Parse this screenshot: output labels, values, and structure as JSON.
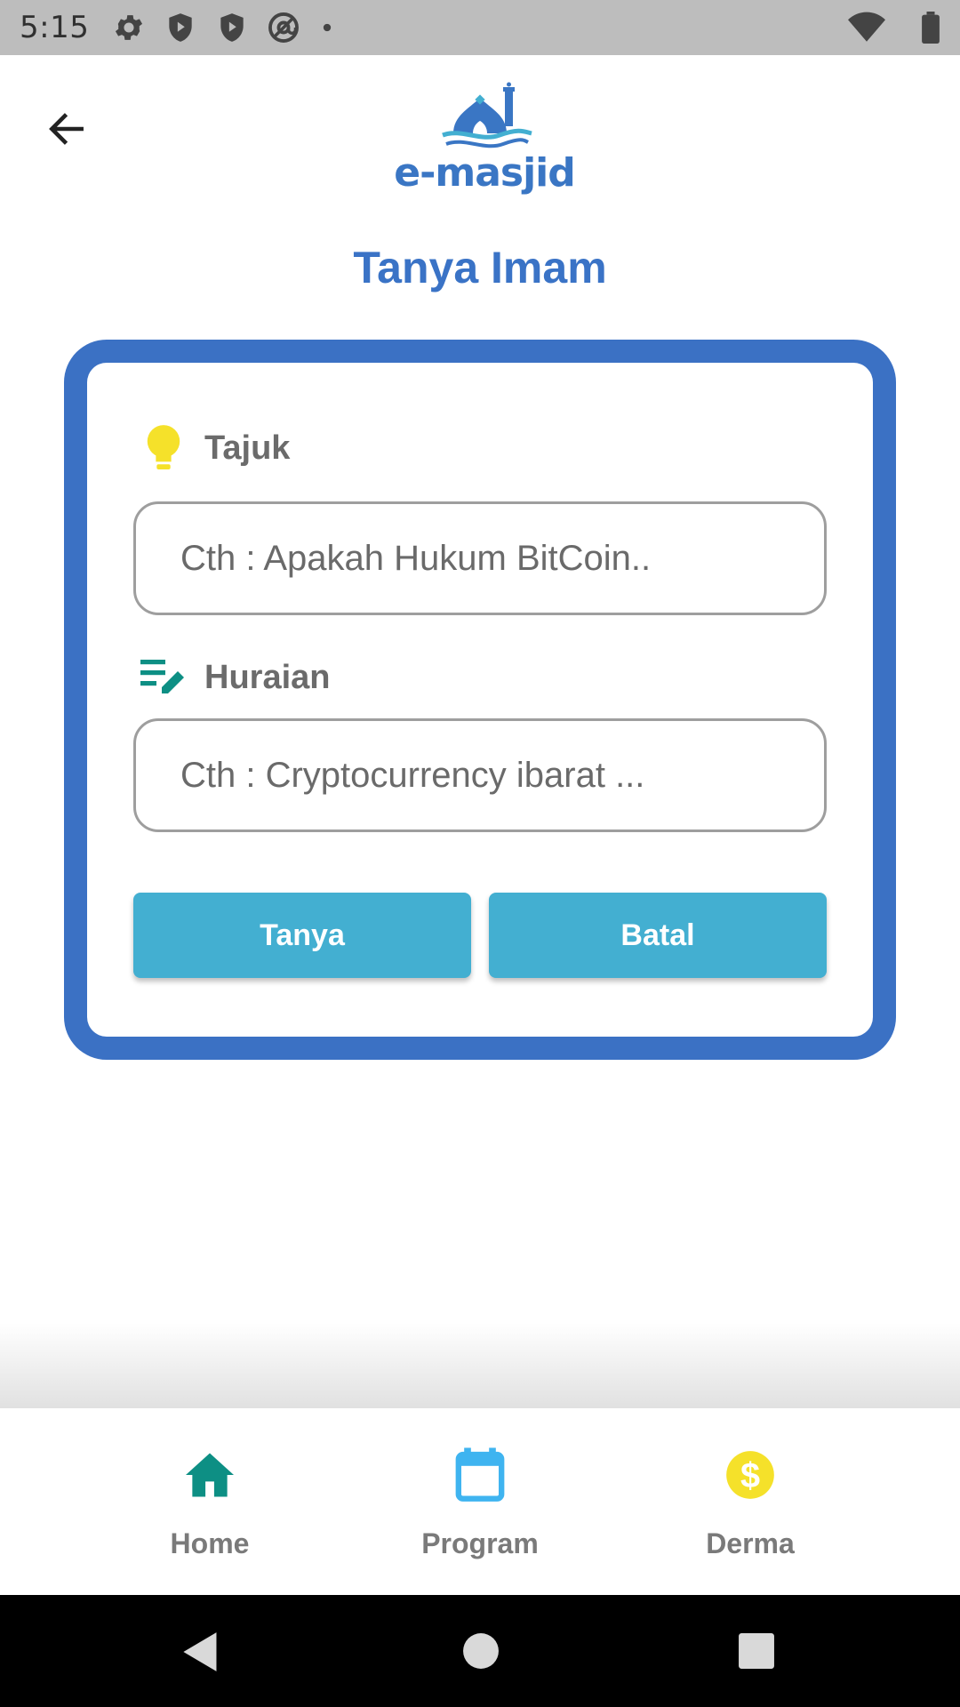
{
  "status_bar": {
    "time": "5:15",
    "icons": [
      "gear-icon",
      "shield-icon",
      "shield-play-icon",
      "at-sign-icon",
      "dot-icon",
      "wifi-icon",
      "battery-icon"
    ]
  },
  "header": {
    "back_icon": "arrow-left-icon",
    "logo_text": "e-masjid"
  },
  "page": {
    "title": "Tanya Imam"
  },
  "form": {
    "tajuk": {
      "label": "Tajuk",
      "icon": "lightbulb-icon",
      "placeholder": "Cth : Apakah Hukum BitCoin..",
      "value": ""
    },
    "huraian": {
      "label": "Huraian",
      "icon": "edit-notes-icon",
      "placeholder": "Cth : Cryptocurrency ibarat ...",
      "value": ""
    },
    "submit_label": "Tanya",
    "cancel_label": "Batal"
  },
  "bottom_nav": {
    "items": [
      {
        "label": "Home",
        "icon": "home-icon",
        "color": "#0d8f84"
      },
      {
        "label": "Program",
        "icon": "calendar-icon",
        "color": "#3fb4f0"
      },
      {
        "label": "Derma",
        "icon": "dollar-coin-icon",
        "color": "#f5e12a"
      }
    ]
  },
  "colors": {
    "accent_blue": "#3b71c4",
    "button": "#43afd1",
    "status_bar": "#bdbdbd"
  }
}
